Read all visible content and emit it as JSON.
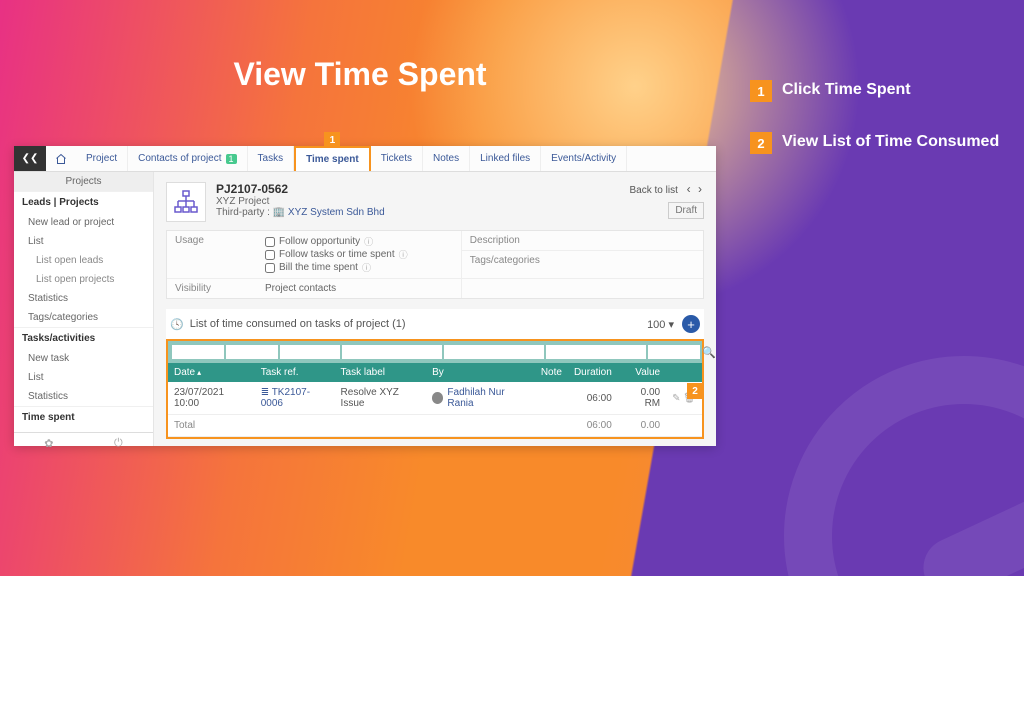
{
  "slide": {
    "title": "View Time Spent",
    "steps": [
      {
        "num": "1",
        "text": "Click Time Spent"
      },
      {
        "num": "2",
        "text": "View List of Time Consumed"
      }
    ]
  },
  "topbar": {
    "tabs": {
      "project": "Project",
      "contacts": "Contacts of project",
      "contacts_badge": "1",
      "tasks": "Tasks",
      "time_spent": "Time spent",
      "tickets": "Tickets",
      "notes": "Notes",
      "linked_files": "Linked files",
      "events": "Events/Activity"
    }
  },
  "sidebar": {
    "header": "Projects",
    "sections": {
      "leads_projects": "Leads | Projects",
      "tasks_activities": "Tasks/activities",
      "time_spent": "Time spent"
    },
    "items": {
      "new_lead": "New lead or project",
      "list": "List",
      "list_open_leads": "List open leads",
      "list_open_projects": "List open projects",
      "statistics": "Statistics",
      "tags": "Tags/categories",
      "new_task": "New task",
      "list2": "List",
      "statistics2": "Statistics"
    }
  },
  "project": {
    "code": "PJ2107-0562",
    "name": "XYZ Project",
    "third_party_label": "Third-party :",
    "third_party_link": "XYZ System Sdn Bhd",
    "back_to_list": "Back to list",
    "draft": "Draft"
  },
  "meta": {
    "usage": "Usage",
    "follow_opp": "Follow opportunity",
    "follow_tasks": "Follow tasks or time spent",
    "bill_time": "Bill the time spent",
    "description": "Description",
    "tags": "Tags/categories",
    "visibility": "Visibility",
    "visibility_val": "Project contacts"
  },
  "list": {
    "title": "List of time consumed on tasks of project (1)",
    "page_size": "100",
    "headers": {
      "date": "Date",
      "task_ref": "Task ref.",
      "task_label": "Task label",
      "by": "By",
      "note": "Note",
      "duration": "Duration",
      "value": "Value"
    },
    "rows": [
      {
        "date": "23/07/2021 10:00",
        "task_ref": "TK2107-0006",
        "task_label": "Resolve XYZ Issue",
        "by": "Fadhilah Nur Rania",
        "note": "",
        "duration": "06:00",
        "value": "0.00 RM"
      }
    ],
    "footer": {
      "label": "Total",
      "duration": "06:00",
      "value": "0.00"
    }
  }
}
